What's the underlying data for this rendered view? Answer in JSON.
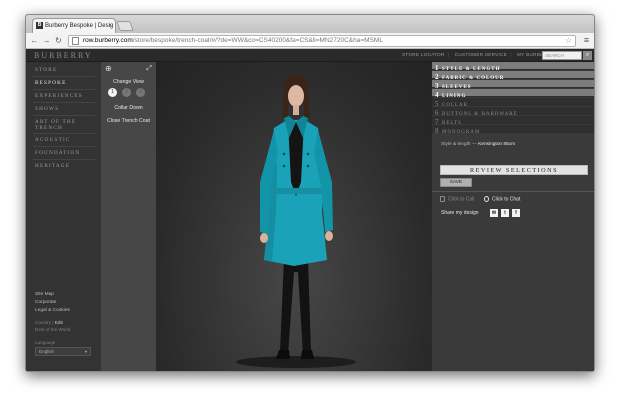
{
  "browser": {
    "tab_title": "Burberry Bespoke | Desig",
    "tab_favicon": "B",
    "tab_close": "×",
    "url_host": "row.burberry.com",
    "url_path": "/store/bespoke/trench-coat/#/?de=WW&co=CS40200&fa=CS&li=MN2720C&ha=MSML"
  },
  "site": {
    "logo": "BURBERRY",
    "top_links": [
      "STORE LOCATOR",
      "CUSTOMER SERVICE",
      "MY BURBERRY"
    ],
    "search_placeholder": "SEARCH"
  },
  "left_nav": {
    "items": [
      "STORE",
      "BESPOKE",
      "EXPERIENCES",
      "SHOWS",
      "ART OF THE\nTRENCH",
      "ACOUSTIC",
      "FOUNDATION",
      "HERITAGE"
    ],
    "active_index": 1,
    "footer_links": [
      "Site Map",
      "Corporate",
      "Legal & Cookies"
    ],
    "country_label": "Country",
    "country_edit": "Edit",
    "country_value": "Rest of the World",
    "language_label": "Language",
    "language_value": "English"
  },
  "view_panel": {
    "title": "Change View",
    "dots": [
      "1",
      "2",
      "3"
    ],
    "active_dot": 0,
    "links": [
      "Collar Down",
      "Close Trench Coat"
    ]
  },
  "steps": [
    {
      "num": "1",
      "label": "STYLE & LENGTH",
      "done": true
    },
    {
      "num": "2",
      "label": "FABRIC & COLOUR",
      "done": true
    },
    {
      "num": "3",
      "label": "SLEEVES",
      "done": true
    },
    {
      "num": "4",
      "label": "LINING",
      "done": true
    },
    {
      "num": "5",
      "label": "COLLAR",
      "done": false
    },
    {
      "num": "6",
      "label": "BUTTONS & HARDWARE",
      "done": false
    },
    {
      "num": "7",
      "label": "BELTS",
      "done": false
    },
    {
      "num": "8",
      "label": "MONOGRAM",
      "done": false
    }
  ],
  "summary": {
    "label": "Style & length",
    "dash": "—",
    "value": "Kensington 85cm"
  },
  "actions": {
    "review": "REVIEW SELECTIONS",
    "save": "SAVE",
    "call": "Click to Call",
    "chat": "Click to Chat",
    "share": "Share my design",
    "share_icons": [
      "✉",
      "t",
      "f"
    ]
  },
  "colors": {
    "coat": "#1aa3b8",
    "page_bg": "#2e2e2e"
  }
}
